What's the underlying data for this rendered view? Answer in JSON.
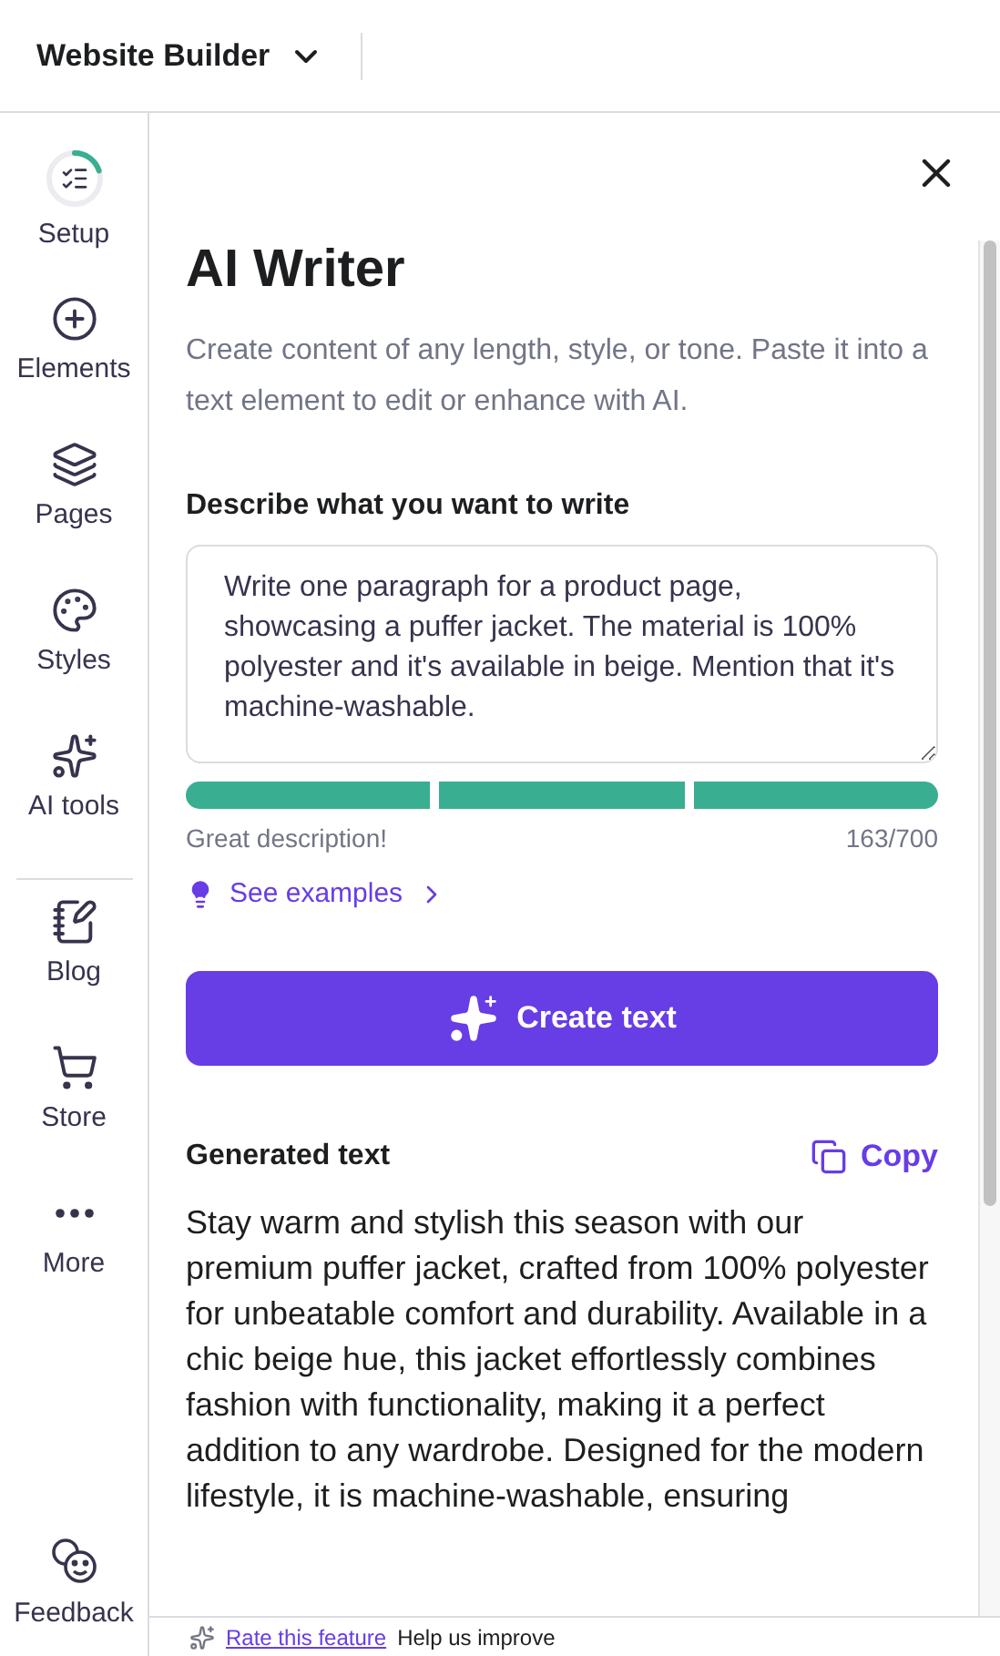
{
  "topbar": {
    "title": "Website Builder"
  },
  "sidebar": {
    "items": [
      {
        "kind": "setup",
        "label": "Setup",
        "level": 0.2
      },
      {
        "kind": "elements",
        "label": "Elements"
      },
      {
        "kind": "pages",
        "label": "Pages"
      },
      {
        "kind": "styles",
        "label": "Styles"
      },
      {
        "kind": "ai",
        "label": "AI tools"
      },
      {
        "kind": "divider"
      },
      {
        "kind": "blog",
        "label": "Blog"
      },
      {
        "kind": "store",
        "label": "Store"
      },
      {
        "kind": "more",
        "label": "More"
      }
    ],
    "feedback": "Feedback"
  },
  "panel": {
    "title": "AI Writer",
    "subtitle": "Create content of any length, style, or tone. Paste it into a text element to edit or enhance with AI.",
    "prompt_label": "Describe what you want to write",
    "prompt_value": "Write one paragraph for a product page, showcasing a puffer jacket. The material is 100% polyester and it's available in beige. Mention that it's machine-washable.",
    "meter": [
      {
        "filled": true
      },
      {
        "filled": true
      },
      {
        "filled": true
      }
    ],
    "meter_label": "Great description!",
    "char_count": "163/700",
    "examples_link": "See examples",
    "create_button": "Create text",
    "generated_label": "Generated text",
    "copy_button": "Copy",
    "generated_text": "Stay warm and stylish this season with our premium puffer jacket, crafted from 100% polyester for unbeatable comfort and durability. Available in a chic beige hue, this jacket effortlessly combines fashion with functionality, making it a perfect addition to any wardrobe. Designed for the modern lifestyle, it is machine-washable, ensuring"
  },
  "footer": {
    "link": "Rate this feature",
    "text": "Help us improve"
  }
}
